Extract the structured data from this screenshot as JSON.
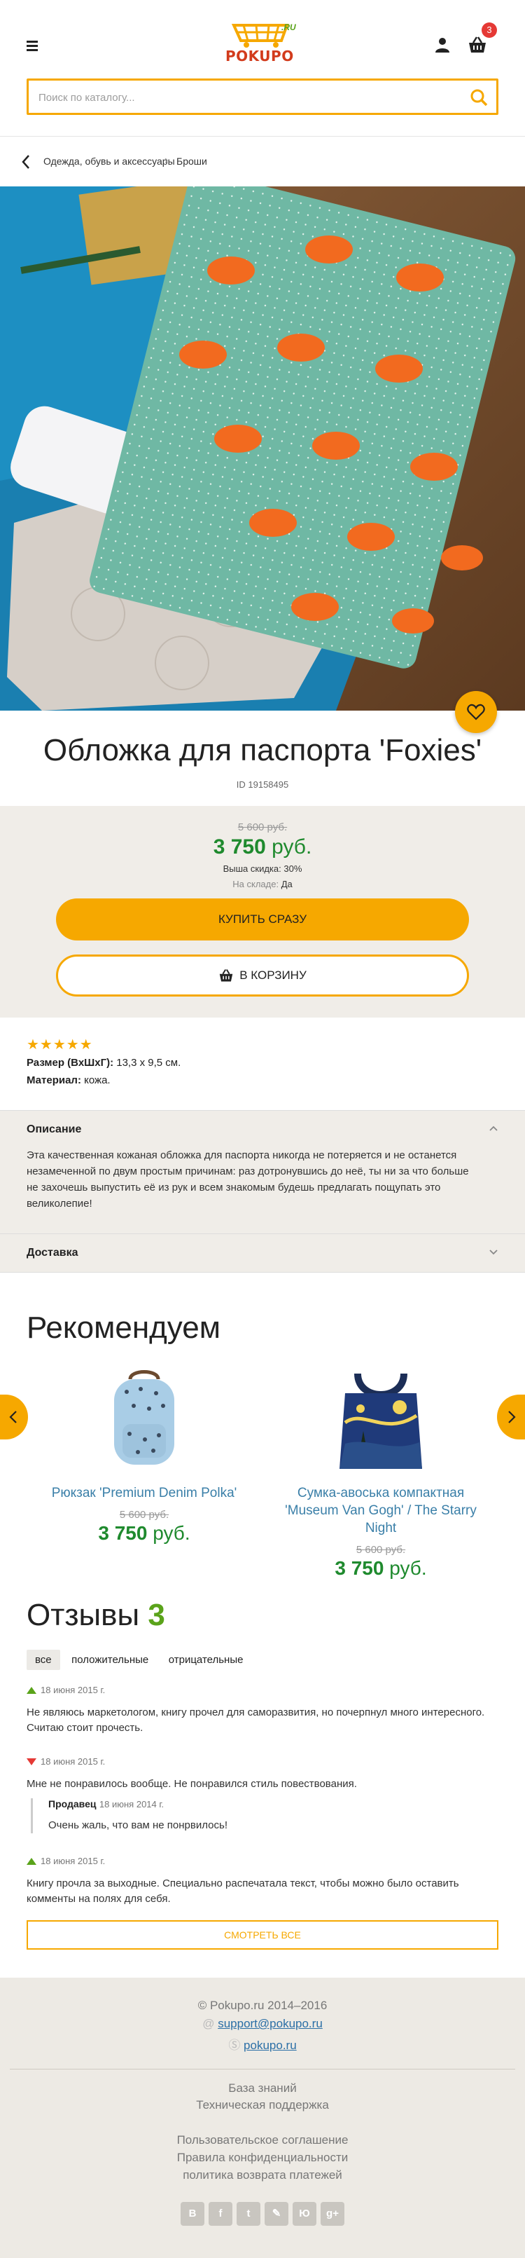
{
  "header": {
    "logo_text": "POKUPO",
    "logo_ru": ".RU",
    "cart_count": "3",
    "search_placeholder": "Поиск по каталогу..."
  },
  "breadcrumb": [
    "Одежда, обувь и аксессуары",
    "Броши"
  ],
  "product": {
    "title": "Обложка для паспорта 'Foxies'",
    "id": "ID 19158495",
    "old_price": "5 600 руб.",
    "new_price_num": "3 750",
    "currency": "руб.",
    "discount": "Выша скидка: 30%",
    "stock_label": "На складе:",
    "stock_value": "Да",
    "buy_now": "Купить сразу",
    "to_cart": "В корзину",
    "rating": 5,
    "size_label": "Размер (ВхШхГ):",
    "size_value": "13,3 х 9,5 см.",
    "material_label": "Материал:",
    "material_value": "кожа."
  },
  "description": {
    "title": "Описание",
    "text": "Эта качественная кожаная обложка для паспорта никогда не потеряется и не останется незамеченной по двум простым причинам: раз дотронувшись до неё, ты ни за что больше не захочешь выпустить её из рук и всем знакомым будешь предлагать пощупать это великолепие!"
  },
  "delivery": {
    "title": "Доставка"
  },
  "recommend": {
    "title": "Рекомендуем",
    "items": [
      {
        "name": "Рюкзак 'Premium Denim Polka'",
        "old_price": "5 600 руб.",
        "new_price_num": "3 750",
        "currency": "руб."
      },
      {
        "name": "Сумка-авоська компактная 'Museum Van Gogh' / The Starry Night",
        "old_price": "5 600 руб.",
        "new_price_num": "3 750",
        "currency": "руб."
      }
    ]
  },
  "reviews": {
    "title": "Отзывы",
    "count": "3",
    "tabs": [
      "все",
      "положительные",
      "отрицательные"
    ],
    "items": [
      {
        "type": "positive",
        "date": "18 июня 2015 г.",
        "text": "Не являюсь маркетологом, книгу прочел для саморазвития, но почерпнул много интересного. Считаю стоит прочесть."
      },
      {
        "type": "negative",
        "date": "18 июня 2015 г.",
        "text": "Мне не понравилось вообще. Не понравился стиль повествования.",
        "reply": {
          "author": "Продавец",
          "date": "18 июня 2014 г.",
          "text": "Очень жаль, что вам не понрвилось!"
        }
      },
      {
        "type": "positive",
        "date": "18 июня 2015 г.",
        "text": "Книгу прочла за выходные. Специально распечатала текст, чтобы можно было оставить комменты на полях для себя."
      }
    ],
    "show_all": "Смотреть все"
  },
  "footer": {
    "copyright": "© Pokupo.ru 2014–2016",
    "email": "support@pokupo.ru",
    "skype": "pokupo.ru",
    "links_a": [
      "База знаний",
      "Техническая поддержка"
    ],
    "links_b": [
      "Пользовательское соглашение",
      "Правила конфиденциальности",
      "политика возврата платежей"
    ],
    "socials": [
      "В",
      "f",
      "t",
      "✎",
      "Ю",
      "g+"
    ]
  },
  "colors": {
    "accent": "#f6a800",
    "price": "#1f8a2e",
    "link": "#3a7fa8",
    "badge": "#e53935"
  }
}
